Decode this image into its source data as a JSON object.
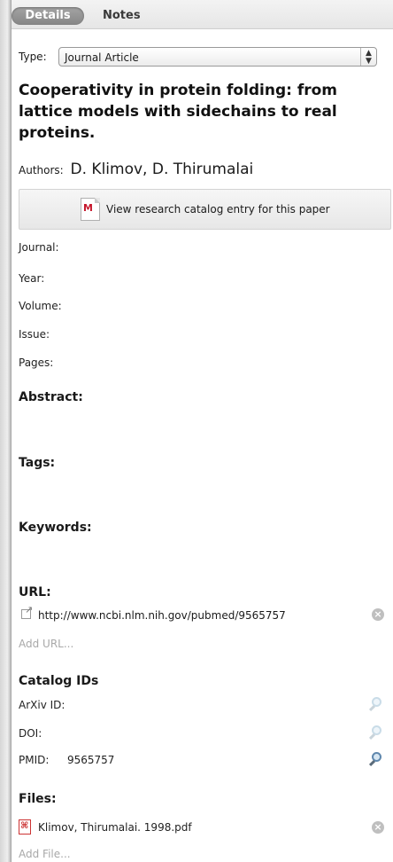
{
  "tabs": {
    "details": "Details",
    "notes": "Notes"
  },
  "type": {
    "label": "Type:",
    "value": "Journal Article"
  },
  "paper": {
    "title": "Cooperativity in protein folding: from lattice models with sidechains to real proteins.",
    "authors_label": "Authors:",
    "authors": "D. Klimov, D. Thirumalai"
  },
  "catalog_button": {
    "label": "View research catalog entry for this paper",
    "icon": "mendeley-icon"
  },
  "fields": {
    "journal": "Journal:",
    "year": "Year:",
    "volume": "Volume:",
    "issue": "Issue:",
    "pages": "Pages:"
  },
  "sections": {
    "abstract": "Abstract:",
    "tags": "Tags:",
    "keywords": "Keywords:",
    "url": "URL:",
    "catalog_ids": "Catalog IDs",
    "files": "Files:"
  },
  "url": {
    "value": "http://www.ncbi.nlm.nih.gov/pubmed/9565757",
    "add_label": "Add URL..."
  },
  "catalog_ids": {
    "arxiv_label": "ArXiv ID:",
    "doi_label": "DOI:",
    "pmid_label": "PMID:",
    "pmid_value": "9565757"
  },
  "files": {
    "file_name": "Klimov, Thirumalai. 1998.pdf",
    "add_label": "Add File..."
  },
  "colors": {
    "active_tab": "#8f8f8f",
    "pdf_red": "#cc3333",
    "muted": "#a8a8a8"
  }
}
